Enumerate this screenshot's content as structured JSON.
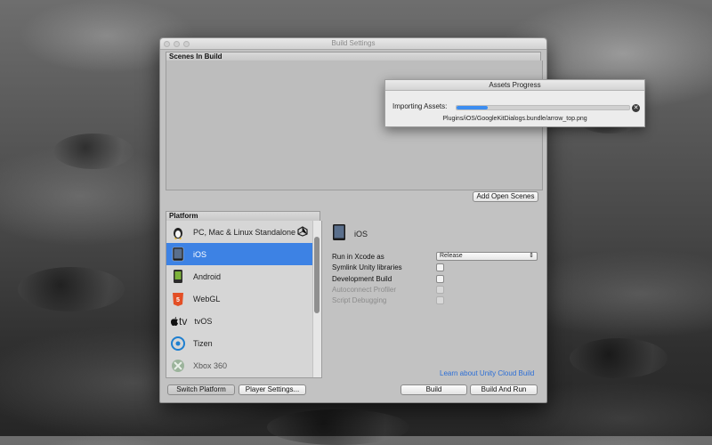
{
  "window": {
    "title": "Build Settings"
  },
  "scenes": {
    "header": "Scenes In Build",
    "add_open_scenes_label": "Add Open Scenes"
  },
  "platform": {
    "header": "Platform",
    "items": [
      {
        "label": "PC, Mac & Linux Standalone",
        "icon": "standalone-penguin-icon",
        "selected": false
      },
      {
        "label": "iOS",
        "icon": "ios-ipad-icon",
        "selected": true
      },
      {
        "label": "Android",
        "icon": "android-phone-icon",
        "selected": false
      },
      {
        "label": "WebGL",
        "icon": "html5-icon",
        "selected": false
      },
      {
        "label": "tvOS",
        "icon": "apple-tv-icon",
        "selected": false
      },
      {
        "label": "Tizen",
        "icon": "tizen-icon",
        "selected": false
      },
      {
        "label": "Xbox 360",
        "icon": "xbox-icon",
        "selected": false
      }
    ],
    "current_target_icon": "unity-icon",
    "selected_title": "iOS"
  },
  "settings": {
    "run_in_xcode_label": "Run in Xcode as",
    "run_in_xcode_value": "Release",
    "symlink_label": "Symlink Unity libraries",
    "development_label": "Development Build",
    "autoconnect_label": "Autoconnect Profiler",
    "script_debug_label": "Script Debugging",
    "symlink_checked": false,
    "development_checked": false,
    "autoconnect_checked": false,
    "script_debug_checked": false
  },
  "links": {
    "cloud_build": "Learn about Unity Cloud Build"
  },
  "buttons": {
    "switch_platform": "Switch Platform",
    "player_settings": "Player Settings...",
    "build": "Build",
    "build_and_run": "Build And Run"
  },
  "progress": {
    "title": "Assets Progress",
    "label": "Importing Assets:",
    "fraction": 0.18,
    "path": "Plugins/iOS/GoogleKitDialogs.bundle/arrow_top.png"
  },
  "colors": {
    "selection": "#3d82e4",
    "progress_fill": "#3c8df0",
    "link": "#2b6ed6"
  }
}
